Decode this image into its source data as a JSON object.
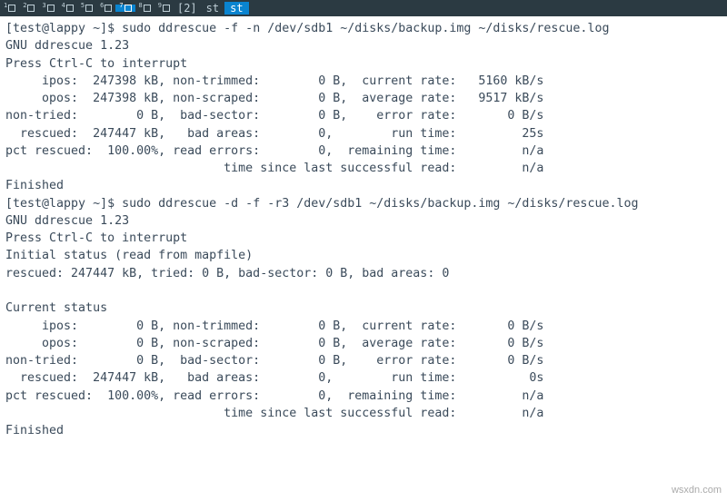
{
  "tabbar": {
    "workspaces": [
      "1",
      "2",
      "3",
      "4",
      "5",
      "6",
      "7",
      "8",
      "9"
    ],
    "active_ws": "7",
    "bracket": "[2]",
    "apps": [
      "st",
      "st"
    ],
    "active_app_index": 1
  },
  "prompt1": "[test@lappy ~]$ ",
  "cmd1": "sudo ddrescue -f -n /dev/sdb1 ~/disks/backup.img ~/disks/rescue.log",
  "block1": {
    "l1": "GNU ddrescue 1.23",
    "l2": "Press Ctrl-C to interrupt",
    "l3": "     ipos:  247398 kB, non-trimmed:        0 B,  current rate:   5160 kB/s",
    "l4": "     opos:  247398 kB, non-scraped:        0 B,  average rate:   9517 kB/s",
    "l5": "non-tried:        0 B,  bad-sector:        0 B,    error rate:       0 B/s",
    "l6": "  rescued:  247447 kB,   bad areas:        0,        run time:         25s",
    "l7": "pct rescued:  100.00%, read errors:        0,  remaining time:         n/a",
    "l8": "                              time since last successful read:         n/a",
    "l9": "Finished"
  },
  "prompt2": "[test@lappy ~]$ ",
  "cmd2": "sudo ddrescue -d -f -r3 /dev/sdb1 ~/disks/backup.img ~/disks/rescue.log",
  "block2": {
    "l1": "GNU ddrescue 1.23",
    "l2": "Press Ctrl-C to interrupt",
    "l3": "Initial status (read from mapfile)",
    "l4": "rescued: 247447 kB, tried: 0 B, bad-sector: 0 B, bad areas: 0",
    "l5": "",
    "l6": "Current status",
    "l7": "     ipos:        0 B, non-trimmed:        0 B,  current rate:       0 B/s",
    "l8": "     opos:        0 B, non-scraped:        0 B,  average rate:       0 B/s",
    "l9": "non-tried:        0 B,  bad-sector:        0 B,    error rate:       0 B/s",
    "l10": "  rescued:  247447 kB,   bad areas:        0,        run time:          0s",
    "l11": "pct rescued:  100.00%, read errors:        0,  remaining time:         n/a",
    "l12": "                              time since last successful read:         n/a",
    "l13": "Finished"
  },
  "watermark": "wsxdn.com"
}
